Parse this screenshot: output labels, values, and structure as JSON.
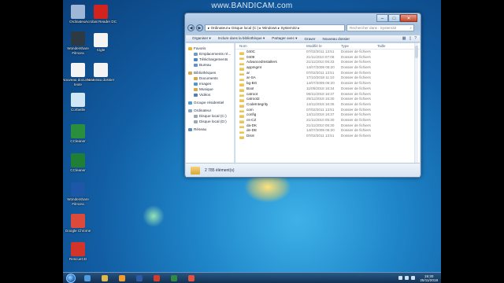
{
  "watermark": "www.BANDICAM.com",
  "desktop_icons": [
    {
      "label": "Ordinateur",
      "icon": "computer-icon",
      "color": "#9fb7d6"
    },
    {
      "label": "Acrobat Reader DC",
      "icon": "acrobat-icon",
      "color": "#d2231c"
    },
    {
      "label": "Wondershare Filmora",
      "icon": "filmora-icon",
      "color": "#2d3a44"
    },
    {
      "label": "Cigle",
      "icon": "document-icon",
      "color": "#f4f4f4"
    },
    {
      "label": "Nouveau document texte",
      "icon": "text-file-icon",
      "color": "#f4f4f4"
    },
    {
      "label": "Nouveau dossier",
      "icon": "text-file-icon",
      "color": "#f4f4f4"
    },
    {
      "label": "Corbeille",
      "icon": "recycle-bin-icon",
      "color": "#cfe6f6"
    },
    {
      "label": "CCleaner",
      "icon": "ccleaner-icon",
      "color": "#2a8f3c"
    },
    {
      "label": "CCleaner",
      "icon": "ccleaner-icon",
      "color": "#1f7f34"
    },
    {
      "label": "Wondershare Filmora",
      "icon": "filmora-icon",
      "color": "#1d57a8"
    },
    {
      "label": "Google Chrome",
      "icon": "chrome-icon",
      "color": "#dd4a3a"
    },
    {
      "label": "RescueCD",
      "icon": "app-icon",
      "color": "#d3342a"
    }
  ],
  "window": {
    "breadcrumb": "▸ Ordinateur ▸ Disque local (C:) ▸ Windows ▸ System32 ▸",
    "search_placeholder": "Rechercher dans : System32",
    "toolbar": [
      "Organiser ▾",
      "Inclure dans la bibliothèque ▾",
      "Partager avec ▾",
      "Graver",
      "Nouveau dossier"
    ],
    "nav": [
      {
        "label": "Favoris",
        "icon": "star-icon",
        "color": "#e5b733",
        "level": 0
      },
      {
        "label": "Emplacements ré...",
        "icon": "recent-icon",
        "color": "#6f9ac8",
        "level": 1
      },
      {
        "label": "Téléchargements",
        "icon": "download-icon",
        "color": "#4a88c8",
        "level": 1
      },
      {
        "label": "Bureau",
        "icon": "desktop-icon",
        "color": "#5f93cf",
        "level": 1
      },
      {
        "label": "",
        "icon": "",
        "color": "",
        "level": 0
      },
      {
        "label": "Bibliothèques",
        "icon": "library-icon",
        "color": "#d7a84c",
        "level": 0
      },
      {
        "label": "Documents",
        "icon": "document-icon",
        "color": "#d7a84c",
        "level": 1
      },
      {
        "label": "Images",
        "icon": "image-icon",
        "color": "#4e96d4",
        "level": 1
      },
      {
        "label": "Musique",
        "icon": "music-icon",
        "color": "#d7a84c",
        "level": 1
      },
      {
        "label": "Vidéos",
        "icon": "video-icon",
        "color": "#4e7fb8",
        "level": 1
      },
      {
        "label": "",
        "icon": "",
        "color": "",
        "level": 0
      },
      {
        "label": "Groupe résidentiel",
        "icon": "homegroup-icon",
        "color": "#4ca0e0",
        "level": 0
      },
      {
        "label": "",
        "icon": "",
        "color": "",
        "level": 0
      },
      {
        "label": "Ordinateur",
        "icon": "computer-icon",
        "color": "#8aa6c4",
        "level": 0
      },
      {
        "label": "Disque local (C:)",
        "icon": "drive-icon",
        "color": "#9aa9b8",
        "level": 1
      },
      {
        "label": "Disque local (D:)",
        "icon": "drive-icon",
        "color": "#9aa9b8",
        "level": 1
      },
      {
        "label": "",
        "icon": "",
        "color": "",
        "level": 0
      },
      {
        "label": "Réseau",
        "icon": "network-icon",
        "color": "#5f8fbf",
        "level": 0
      }
    ],
    "columns": [
      "Nom",
      "Modifié le",
      "Type",
      "Taille"
    ],
    "files": [
      {
        "name": "040C",
        "date": "07/02/2011 13:51",
        "type": "Dossier de fichiers"
      },
      {
        "name": "0409",
        "date": "21/11/2010 07:06",
        "type": "Dossier de fichiers"
      },
      {
        "name": "AdvancedInstallers",
        "date": "21/11/2010 05:33",
        "type": "Dossier de fichiers"
      },
      {
        "name": "appmgmt",
        "date": "14/07/2009 06:20",
        "type": "Dossier de fichiers"
      },
      {
        "name": "ar",
        "date": "07/02/2011 13:51",
        "type": "Dossier de fichiers"
      },
      {
        "name": "ar-SA",
        "date": "17/10/2018 11:10",
        "type": "Dossier de fichiers"
      },
      {
        "name": "bg-BG",
        "date": "14/07/2009 06:20",
        "type": "Dossier de fichiers"
      },
      {
        "name": "Boot",
        "date": "11/05/2018 16:34",
        "type": "Dossier de fichiers"
      },
      {
        "name": "catroot",
        "date": "06/11/2018 16:37",
        "type": "Dossier de fichiers"
      },
      {
        "name": "catroot2",
        "date": "25/11/2018 15:30",
        "type": "Dossier de fichiers"
      },
      {
        "name": "CodeIntegrity",
        "date": "14/11/2018 16:35",
        "type": "Dossier de fichiers"
      },
      {
        "name": "com",
        "date": "07/02/2011 13:51",
        "type": "Dossier de fichiers"
      },
      {
        "name": "config",
        "date": "14/11/2018 16:37",
        "type": "Dossier de fichiers"
      },
      {
        "name": "cs-CZ",
        "date": "21/11/2010 05:30",
        "type": "Dossier de fichiers"
      },
      {
        "name": "da-DK",
        "date": "21/11/2010 05:30",
        "type": "Dossier de fichiers"
      },
      {
        "name": "de-DE",
        "date": "14/07/2009 06:20",
        "type": "Dossier de fichiers"
      },
      {
        "name": "Dism",
        "date": "07/02/2011 13:51",
        "type": "Dossier de fichiers"
      }
    ],
    "status": "2 785 élément(s)"
  },
  "taskbar": {
    "items": [
      {
        "icon": "ie-icon",
        "color": "#4e9be0"
      },
      {
        "icon": "explorer-icon",
        "color": "#e0b84d"
      },
      {
        "icon": "media-player-icon",
        "color": "#f29b2f"
      },
      {
        "icon": "word-icon",
        "color": "#2d5aa7"
      },
      {
        "icon": "pdf-icon",
        "color": "#d43b2c"
      },
      {
        "icon": "excel-icon",
        "color": "#2f8a45"
      },
      {
        "icon": "chrome-icon",
        "color": "#e5513f"
      }
    ],
    "time": "15:30",
    "date": "25/11/2018"
  }
}
